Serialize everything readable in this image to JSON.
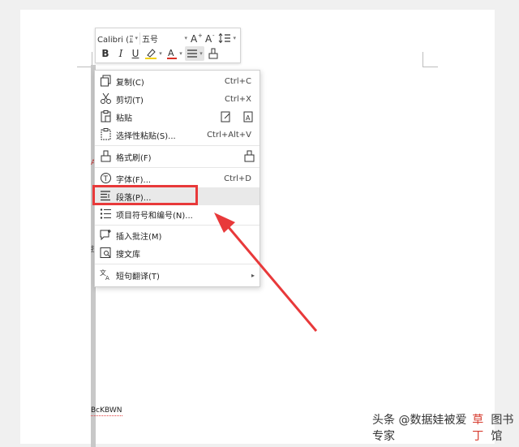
{
  "document": {
    "text_fragment": "BcKBWN",
    "side_fragments": [
      "A",
      "技"
    ]
  },
  "toolbar": {
    "font_name": "Calibri (正",
    "font_size": "五号",
    "buttons": [
      {
        "name": "grow-font-button",
        "glyph": "A⁺"
      },
      {
        "name": "shrink-font-button",
        "glyph": "A⁻"
      },
      {
        "name": "line-spacing-button",
        "glyph": "↕≡"
      }
    ],
    "format_buttons": [
      {
        "name": "bold-button",
        "glyph": "B"
      },
      {
        "name": "italic-button",
        "glyph": "I"
      },
      {
        "name": "underline-button",
        "glyph": "U"
      }
    ]
  },
  "context_menu": {
    "items": [
      {
        "label": "复制(C)",
        "shortcut": "Ctrl+C",
        "icon": "copy-icon"
      },
      {
        "label": "剪切(T)",
        "shortcut": "Ctrl+X",
        "icon": "scissors-icon"
      },
      {
        "label": "粘贴",
        "shortcut": "",
        "icon": "paste-icon"
      },
      {
        "label": "选择性粘贴(S)...",
        "shortcut": "Ctrl+Alt+V",
        "icon": "paste-special-icon"
      },
      {
        "label": "格式刷(F)",
        "shortcut": "",
        "icon": "format-painter-icon"
      },
      {
        "label": "字体(F)...",
        "shortcut": "Ctrl+D",
        "icon": "font-icon"
      },
      {
        "label": "段落(P)...",
        "shortcut": "",
        "icon": "paragraph-icon"
      },
      {
        "label": "项目符号和编号(N)...",
        "shortcut": "",
        "icon": "bullet-list-icon"
      },
      {
        "label": "插入批注(M)",
        "shortcut": "",
        "icon": "comment-icon"
      },
      {
        "label": "搜文库",
        "shortcut": "",
        "icon": "search-library-icon"
      },
      {
        "label": "短句翻译(T)",
        "shortcut": "",
        "icon": "translate-icon"
      }
    ]
  },
  "annotation": {
    "color": "#e8393a",
    "highlighted_item": "段落(P)..."
  },
  "watermark": {
    "prefix": "头条 @数据娃被爱专家",
    "brand_accent": "草丁",
    "brand_rest": "图书馆"
  }
}
